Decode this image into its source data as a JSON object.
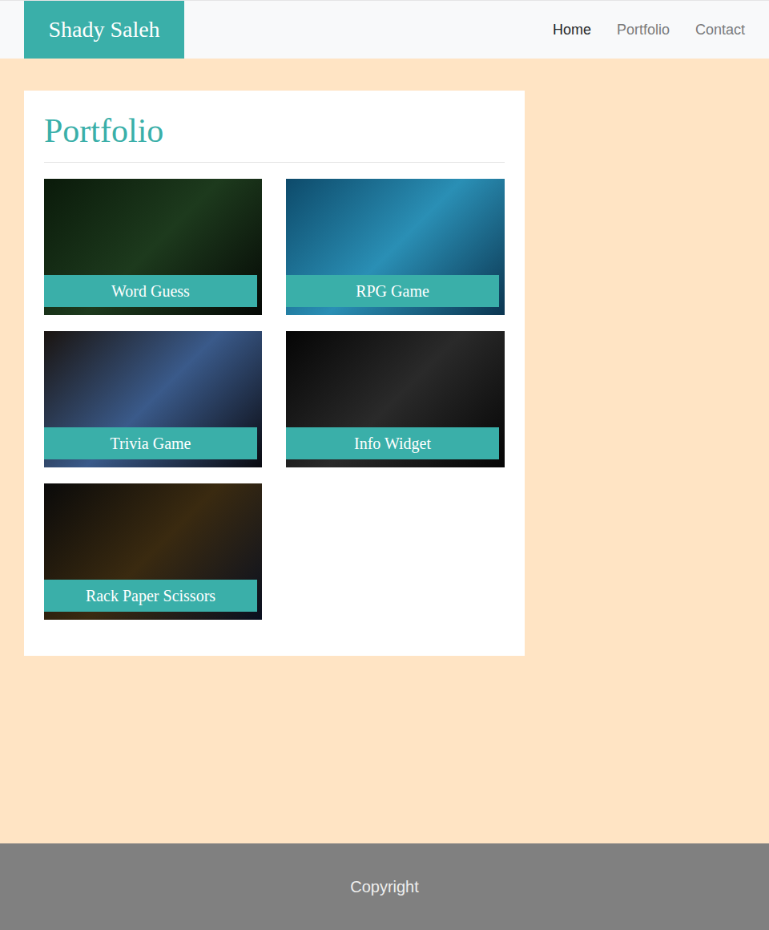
{
  "brand": "Shady Saleh",
  "nav": [
    {
      "label": "Home",
      "selected": true
    },
    {
      "label": "Portfolio",
      "selected": false
    },
    {
      "label": "Contact",
      "selected": false
    }
  ],
  "portfolio": {
    "title": "Portfolio",
    "projects": [
      {
        "title": "Word Guess"
      },
      {
        "title": "RPG Game"
      },
      {
        "title": "Trivia Game"
      },
      {
        "title": "Info Widget"
      },
      {
        "title": "Rack Paper Scissors"
      }
    ]
  },
  "footer": {
    "text": "Copyright"
  }
}
